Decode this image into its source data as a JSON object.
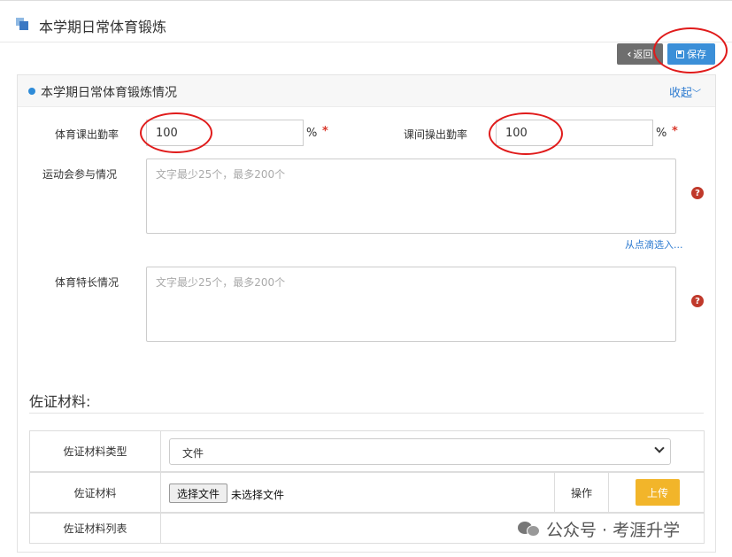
{
  "page": {
    "title": "本学期日常体育锻炼"
  },
  "toolbar": {
    "back_label": "返回",
    "save_label": "保存"
  },
  "panel": {
    "title": "本学期日常体育锻炼情况",
    "collapse_label": "收起"
  },
  "form": {
    "pe_attendance": {
      "label": "体育课出勤率",
      "value": "100",
      "unit": "%",
      "required_mark": "*"
    },
    "exercise_attendance": {
      "label": "课间操出勤率",
      "value": "100",
      "unit": "%",
      "required_mark": "*"
    },
    "sports_meet": {
      "label": "运动会参与情况",
      "placeholder": "文字最少25个，最多200个",
      "pick_link": "从点滴选入..."
    },
    "sports_talent": {
      "label": "体育特长情况",
      "placeholder": "文字最少25个，最多200个"
    },
    "help_glyph": "?"
  },
  "evidence": {
    "section_title": "佐证材料:",
    "type_label": "佐证材料类型",
    "type_value": "文件",
    "material_label": "佐证材料",
    "choose_file_label": "选择文件",
    "no_file_text": "未选择文件",
    "operation_label": "操作",
    "upload_label": "上传",
    "list_label": "佐证材料列表"
  },
  "watermark": {
    "text": "公众号 · 考涯升学"
  },
  "colors": {
    "primary": "#3b8fd8",
    "back": "#6e6e6e",
    "upload": "#f2b52a",
    "required": "#d9382b",
    "annotation": "#e01b1b"
  }
}
